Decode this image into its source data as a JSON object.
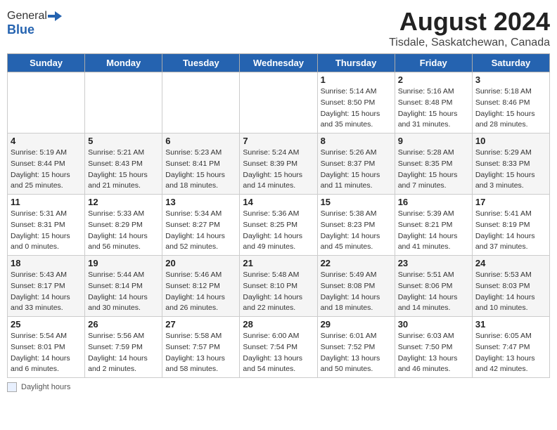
{
  "header": {
    "logo_general": "General",
    "logo_blue": "Blue",
    "title": "August 2024",
    "subtitle": "Tisdale, Saskatchewan, Canada"
  },
  "weekdays": [
    "Sunday",
    "Monday",
    "Tuesday",
    "Wednesday",
    "Thursday",
    "Friday",
    "Saturday"
  ],
  "weeks": [
    [
      {
        "day": "",
        "info": ""
      },
      {
        "day": "",
        "info": ""
      },
      {
        "day": "",
        "info": ""
      },
      {
        "day": "",
        "info": ""
      },
      {
        "day": "1",
        "info": "Sunrise: 5:14 AM\nSunset: 8:50 PM\nDaylight: 15 hours and 35 minutes."
      },
      {
        "day": "2",
        "info": "Sunrise: 5:16 AM\nSunset: 8:48 PM\nDaylight: 15 hours and 31 minutes."
      },
      {
        "day": "3",
        "info": "Sunrise: 5:18 AM\nSunset: 8:46 PM\nDaylight: 15 hours and 28 minutes."
      }
    ],
    [
      {
        "day": "4",
        "info": "Sunrise: 5:19 AM\nSunset: 8:44 PM\nDaylight: 15 hours and 25 minutes."
      },
      {
        "day": "5",
        "info": "Sunrise: 5:21 AM\nSunset: 8:43 PM\nDaylight: 15 hours and 21 minutes."
      },
      {
        "day": "6",
        "info": "Sunrise: 5:23 AM\nSunset: 8:41 PM\nDaylight: 15 hours and 18 minutes."
      },
      {
        "day": "7",
        "info": "Sunrise: 5:24 AM\nSunset: 8:39 PM\nDaylight: 15 hours and 14 minutes."
      },
      {
        "day": "8",
        "info": "Sunrise: 5:26 AM\nSunset: 8:37 PM\nDaylight: 15 hours and 11 minutes."
      },
      {
        "day": "9",
        "info": "Sunrise: 5:28 AM\nSunset: 8:35 PM\nDaylight: 15 hours and 7 minutes."
      },
      {
        "day": "10",
        "info": "Sunrise: 5:29 AM\nSunset: 8:33 PM\nDaylight: 15 hours and 3 minutes."
      }
    ],
    [
      {
        "day": "11",
        "info": "Sunrise: 5:31 AM\nSunset: 8:31 PM\nDaylight: 15 hours and 0 minutes."
      },
      {
        "day": "12",
        "info": "Sunrise: 5:33 AM\nSunset: 8:29 PM\nDaylight: 14 hours and 56 minutes."
      },
      {
        "day": "13",
        "info": "Sunrise: 5:34 AM\nSunset: 8:27 PM\nDaylight: 14 hours and 52 minutes."
      },
      {
        "day": "14",
        "info": "Sunrise: 5:36 AM\nSunset: 8:25 PM\nDaylight: 14 hours and 49 minutes."
      },
      {
        "day": "15",
        "info": "Sunrise: 5:38 AM\nSunset: 8:23 PM\nDaylight: 14 hours and 45 minutes."
      },
      {
        "day": "16",
        "info": "Sunrise: 5:39 AM\nSunset: 8:21 PM\nDaylight: 14 hours and 41 minutes."
      },
      {
        "day": "17",
        "info": "Sunrise: 5:41 AM\nSunset: 8:19 PM\nDaylight: 14 hours and 37 minutes."
      }
    ],
    [
      {
        "day": "18",
        "info": "Sunrise: 5:43 AM\nSunset: 8:17 PM\nDaylight: 14 hours and 33 minutes."
      },
      {
        "day": "19",
        "info": "Sunrise: 5:44 AM\nSunset: 8:14 PM\nDaylight: 14 hours and 30 minutes."
      },
      {
        "day": "20",
        "info": "Sunrise: 5:46 AM\nSunset: 8:12 PM\nDaylight: 14 hours and 26 minutes."
      },
      {
        "day": "21",
        "info": "Sunrise: 5:48 AM\nSunset: 8:10 PM\nDaylight: 14 hours and 22 minutes."
      },
      {
        "day": "22",
        "info": "Sunrise: 5:49 AM\nSunset: 8:08 PM\nDaylight: 14 hours and 18 minutes."
      },
      {
        "day": "23",
        "info": "Sunrise: 5:51 AM\nSunset: 8:06 PM\nDaylight: 14 hours and 14 minutes."
      },
      {
        "day": "24",
        "info": "Sunrise: 5:53 AM\nSunset: 8:03 PM\nDaylight: 14 hours and 10 minutes."
      }
    ],
    [
      {
        "day": "25",
        "info": "Sunrise: 5:54 AM\nSunset: 8:01 PM\nDaylight: 14 hours and 6 minutes."
      },
      {
        "day": "26",
        "info": "Sunrise: 5:56 AM\nSunset: 7:59 PM\nDaylight: 14 hours and 2 minutes."
      },
      {
        "day": "27",
        "info": "Sunrise: 5:58 AM\nSunset: 7:57 PM\nDaylight: 13 hours and 58 minutes."
      },
      {
        "day": "28",
        "info": "Sunrise: 6:00 AM\nSunset: 7:54 PM\nDaylight: 13 hours and 54 minutes."
      },
      {
        "day": "29",
        "info": "Sunrise: 6:01 AM\nSunset: 7:52 PM\nDaylight: 13 hours and 50 minutes."
      },
      {
        "day": "30",
        "info": "Sunrise: 6:03 AM\nSunset: 7:50 PM\nDaylight: 13 hours and 46 minutes."
      },
      {
        "day": "31",
        "info": "Sunrise: 6:05 AM\nSunset: 7:47 PM\nDaylight: 13 hours and 42 minutes."
      }
    ]
  ],
  "legend": {
    "label": "Daylight hours"
  }
}
